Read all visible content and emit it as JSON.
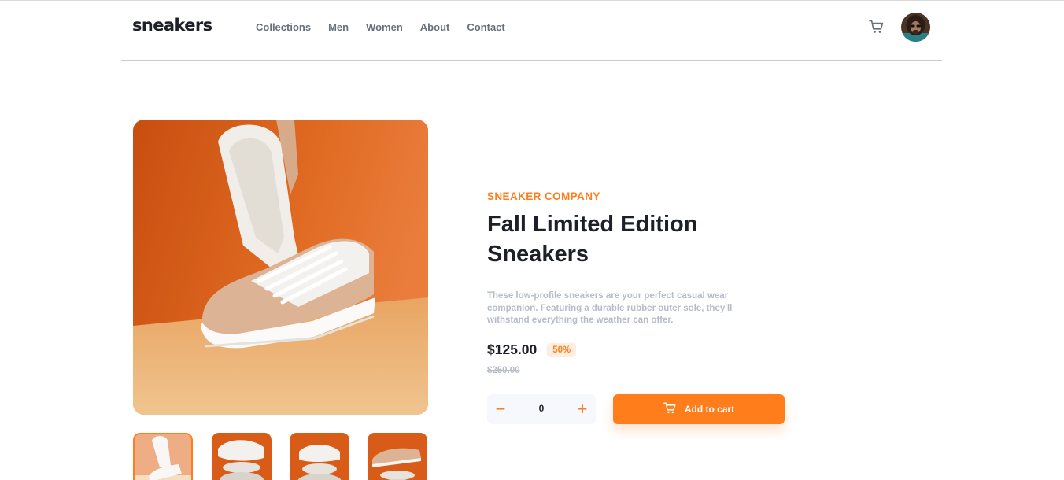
{
  "header": {
    "logo": "sneakers",
    "nav": [
      {
        "label": "Collections"
      },
      {
        "label": "Men"
      },
      {
        "label": "Women"
      },
      {
        "label": "About"
      },
      {
        "label": "Contact"
      }
    ],
    "cart_icon": "cart-icon",
    "avatar_icon": "user-avatar"
  },
  "product": {
    "company": "SNEAKER COMPANY",
    "title": "Fall Limited Edition Sneakers",
    "description": "These low-profile sneakers are your perfect casual wear companion. Featuring a durable rubber outer sole, they'll withstand everything the weather can offer.",
    "price": "$125.00",
    "discount": "50%",
    "old_price": "$250.00",
    "quantity": "0",
    "minus_symbol": "−",
    "plus_symbol": "+",
    "add_to_cart": "Add to cart",
    "selected_thumbnail": 1,
    "thumbnail_count": 4
  },
  "colors": {
    "accent": "#ff7d1a",
    "accent_pale": "#ffede0",
    "text_dark": "#1d2026",
    "text_gray": "#69707d",
    "text_light": "#b6bcc8"
  }
}
